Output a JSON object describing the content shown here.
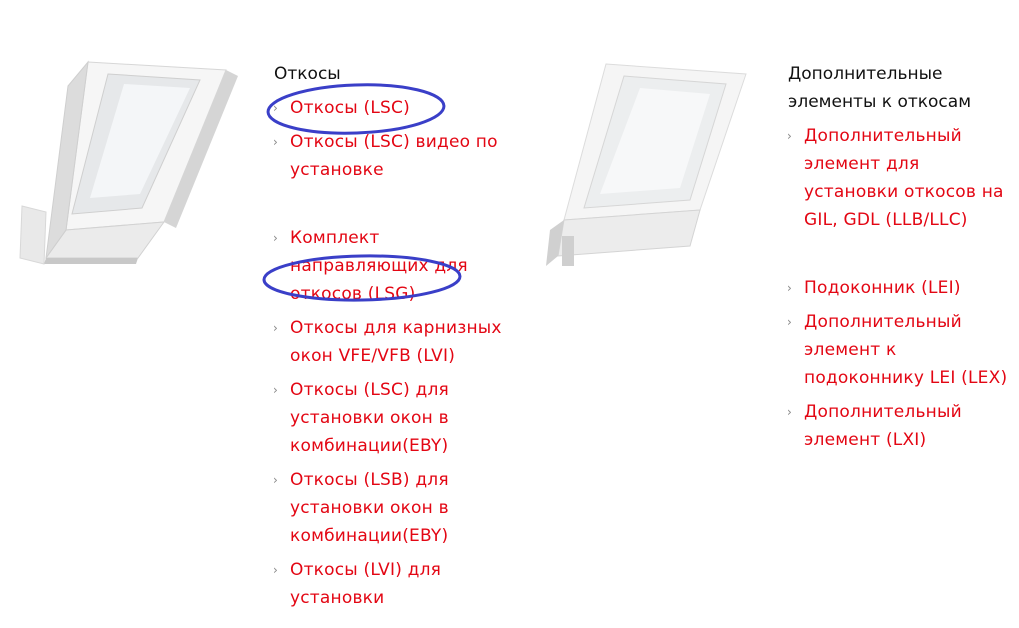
{
  "left_section": {
    "title": "Откосы",
    "image_icon": "roof-window-lining-icon",
    "links": [
      {
        "label": "Откосы (LSC)",
        "highlighted": true
      },
      {
        "label": "Откосы (LSC) видео по установке",
        "highlighted": false
      },
      {
        "label": "Комплект направляющих для откосов (LSG)",
        "highlighted": true
      },
      {
        "label": "Откосы для карнизных окон VFE/VFB (LVI)",
        "highlighted": false
      },
      {
        "label": "Откосы (LSC) для установки окон в комбинации(EBY)",
        "highlighted": false
      },
      {
        "label": "Откосы (LSB) для установки окон в комбинации(EBY)",
        "highlighted": false
      },
      {
        "label": "Откосы (LVI) для установки",
        "highlighted": false
      }
    ]
  },
  "right_section": {
    "title": "Дополнительные элементы к откосам",
    "image_icon": "roof-window-lining-accessory-icon",
    "links": [
      {
        "label": "Дополнительный элемент для установки откосов на GIL, GDL (LLB/LLC)"
      },
      {
        "label": "Подоконник (LEI)"
      },
      {
        "label": "Дополнительный элемент к подоконнику LEI (LEX)"
      },
      {
        "label": "Дополнительный элемент (LXI)"
      }
    ]
  },
  "colors": {
    "link": "#e30613",
    "chevron": "#888888",
    "title": "#111111",
    "highlight_ellipse": "#3a3fc8"
  },
  "chevron_icon": "chevron-right-icon"
}
